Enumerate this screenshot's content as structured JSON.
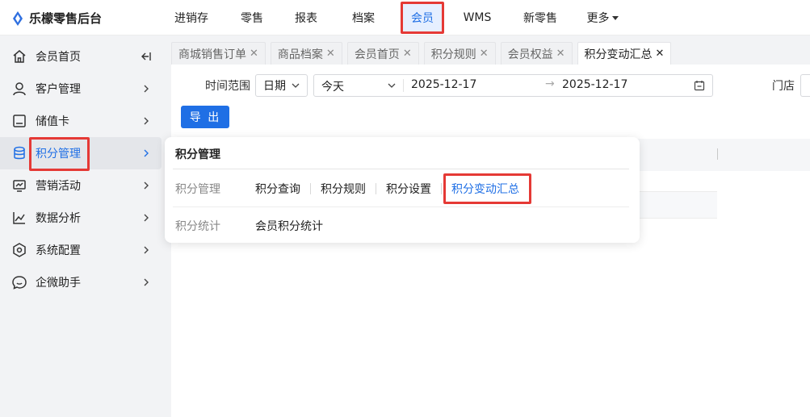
{
  "app": {
    "title": "乐檬零售后台"
  },
  "topnav": {
    "items": [
      {
        "label": "进销存"
      },
      {
        "label": "零售"
      },
      {
        "label": "报表"
      },
      {
        "label": "档案"
      },
      {
        "label": "会员",
        "active": true
      },
      {
        "label": "WMS"
      },
      {
        "label": "新零售"
      },
      {
        "label": "更多"
      }
    ]
  },
  "sidebar": {
    "items": [
      {
        "label": "会员首页",
        "icon": "home-icon"
      },
      {
        "label": "客户管理",
        "icon": "user-icon"
      },
      {
        "label": "储值卡",
        "icon": "card-icon"
      },
      {
        "label": "积分管理",
        "icon": "database-icon",
        "active": true
      },
      {
        "label": "营销活动",
        "icon": "campaign-icon"
      },
      {
        "label": "数据分析",
        "icon": "chart-line-icon"
      },
      {
        "label": "系统配置",
        "icon": "settings-icon"
      },
      {
        "label": "企微助手",
        "icon": "chat-icon"
      }
    ]
  },
  "tabs": [
    {
      "label": "商城销售订单"
    },
    {
      "label": "商品档案"
    },
    {
      "label": "会员首页"
    },
    {
      "label": "积分规则"
    },
    {
      "label": "会员权益"
    },
    {
      "label": "积分变动汇总",
      "active": true
    }
  ],
  "filters": {
    "time_range_label": "时间范围",
    "date_type": "日期",
    "period": "今天",
    "start_date": "2025-12-17",
    "end_date": "2025-12-17",
    "store_label": "门店"
  },
  "export_label": "导 出",
  "popup": {
    "title": "积分管理",
    "groups": [
      {
        "label": "积分管理",
        "links": [
          "积分查询",
          "积分规则",
          "积分设置",
          "积分变动汇总"
        ],
        "active": "积分变动汇总"
      },
      {
        "label": "积分统计",
        "links": [
          "会员积分统计"
        ]
      }
    ]
  },
  "colors": {
    "accent": "#1f6fe5",
    "highlight": "#e53935",
    "sidebar_bg": "#f2f3f5"
  }
}
